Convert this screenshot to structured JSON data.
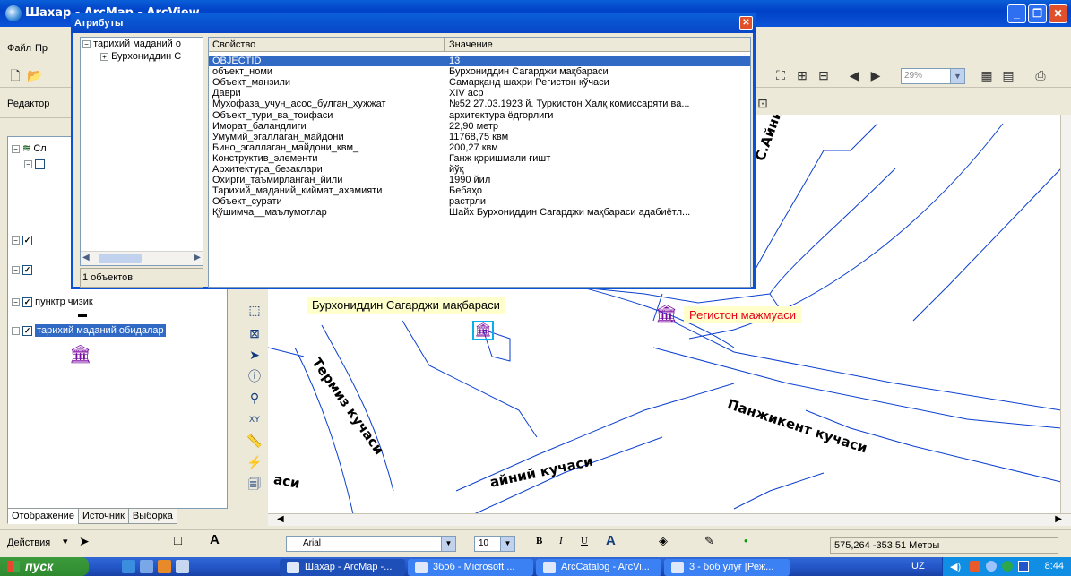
{
  "window": {
    "title": "Шахар - ArcMap - ArcView"
  },
  "menubar": {
    "items": [
      "Файл",
      "Пр"
    ]
  },
  "toolbar": {
    "zoom_value": "29%",
    "editor_label": "Редактор"
  },
  "toc": {
    "root_label": "Сл",
    "layers": [
      {
        "label": "пунктр чизик",
        "checked": true
      },
      {
        "label": "тарихий маданий обидалар",
        "checked": true,
        "selected": true
      }
    ],
    "tabs": [
      "Отображение",
      "Источник",
      "Выборка"
    ]
  },
  "attributes": {
    "title": "Атрибуты",
    "tree": {
      "layer": "тарихий маданий о",
      "feature": "Бурхониддин С"
    },
    "count": "1 объектов",
    "headers": {
      "property": "Свойство",
      "value": "Значение"
    },
    "rows": [
      {
        "key": "OBJECTID",
        "value": "13"
      },
      {
        "key": "объект_номи",
        "value": "Бурхониддин Сагарджи мақбараси"
      },
      {
        "key": "Объект_манзили",
        "value": "Самарқанд шахри Регистон кўчаси"
      },
      {
        "key": "Даври",
        "value": "XIV аср"
      },
      {
        "key": "Мухофаза_учун_асос_булган_хужжат",
        "value": "№52 27.03.1923 й. Туркистон Халқ комиссаряти ва..."
      },
      {
        "key": "Объект_тури_ва_тоифаси",
        "value": "архитектура ёдгорлиги"
      },
      {
        "key": "Иморат_баландлиги",
        "value": "22,90 метр"
      },
      {
        "key": "Умумий_эгаллаган_майдони",
        "value": "11768,75 квм"
      },
      {
        "key": "Бино_эгаллаган_майдони_квм_",
        "value": "200,27 квм"
      },
      {
        "key": "Конструктив_элементи",
        "value": "Ганж қоришмали ғишт"
      },
      {
        "key": "Архитектура_безаклари",
        "value": "йўқ"
      },
      {
        "key": "Охирги_таъмирланган_йили",
        "value": "1990 йил"
      },
      {
        "key": "Тарихий_маданий_киймат_ахамияти",
        "value": "Бебаҳо"
      },
      {
        "key": "Объект_сурати",
        "value": "растрли"
      },
      {
        "key": "Қўшимча__маълумотлар",
        "value": "Шайх Бурхониддин Сагарджи мақбараси адабиётл..."
      }
    ]
  },
  "map": {
    "streets": [
      "С.Айний кучаси",
      "Термиз кучаси",
      "Панжикент кучаси",
      "айний кучаси",
      "аси"
    ],
    "labels": {
      "selected": "Бурхониддин Сагарджи мақбараси",
      "other": "Регистон мажмуаси"
    },
    "label_color": "#e8001c",
    "icon_color": "#7b0da0"
  },
  "drawbar": {
    "actions_label": "Действия",
    "font": "Arial",
    "size": "10"
  },
  "status": {
    "coords": "575,264  -353,51 Метры"
  },
  "taskbar": {
    "start": "пуск",
    "items": [
      "Шахар - ArcMap -...",
      "3боб - Microsoft ...",
      "ArcCatalog - ArcVi...",
      "3 - боб улуғ [Реж..."
    ],
    "lang": "UZ",
    "time": "8:44"
  }
}
